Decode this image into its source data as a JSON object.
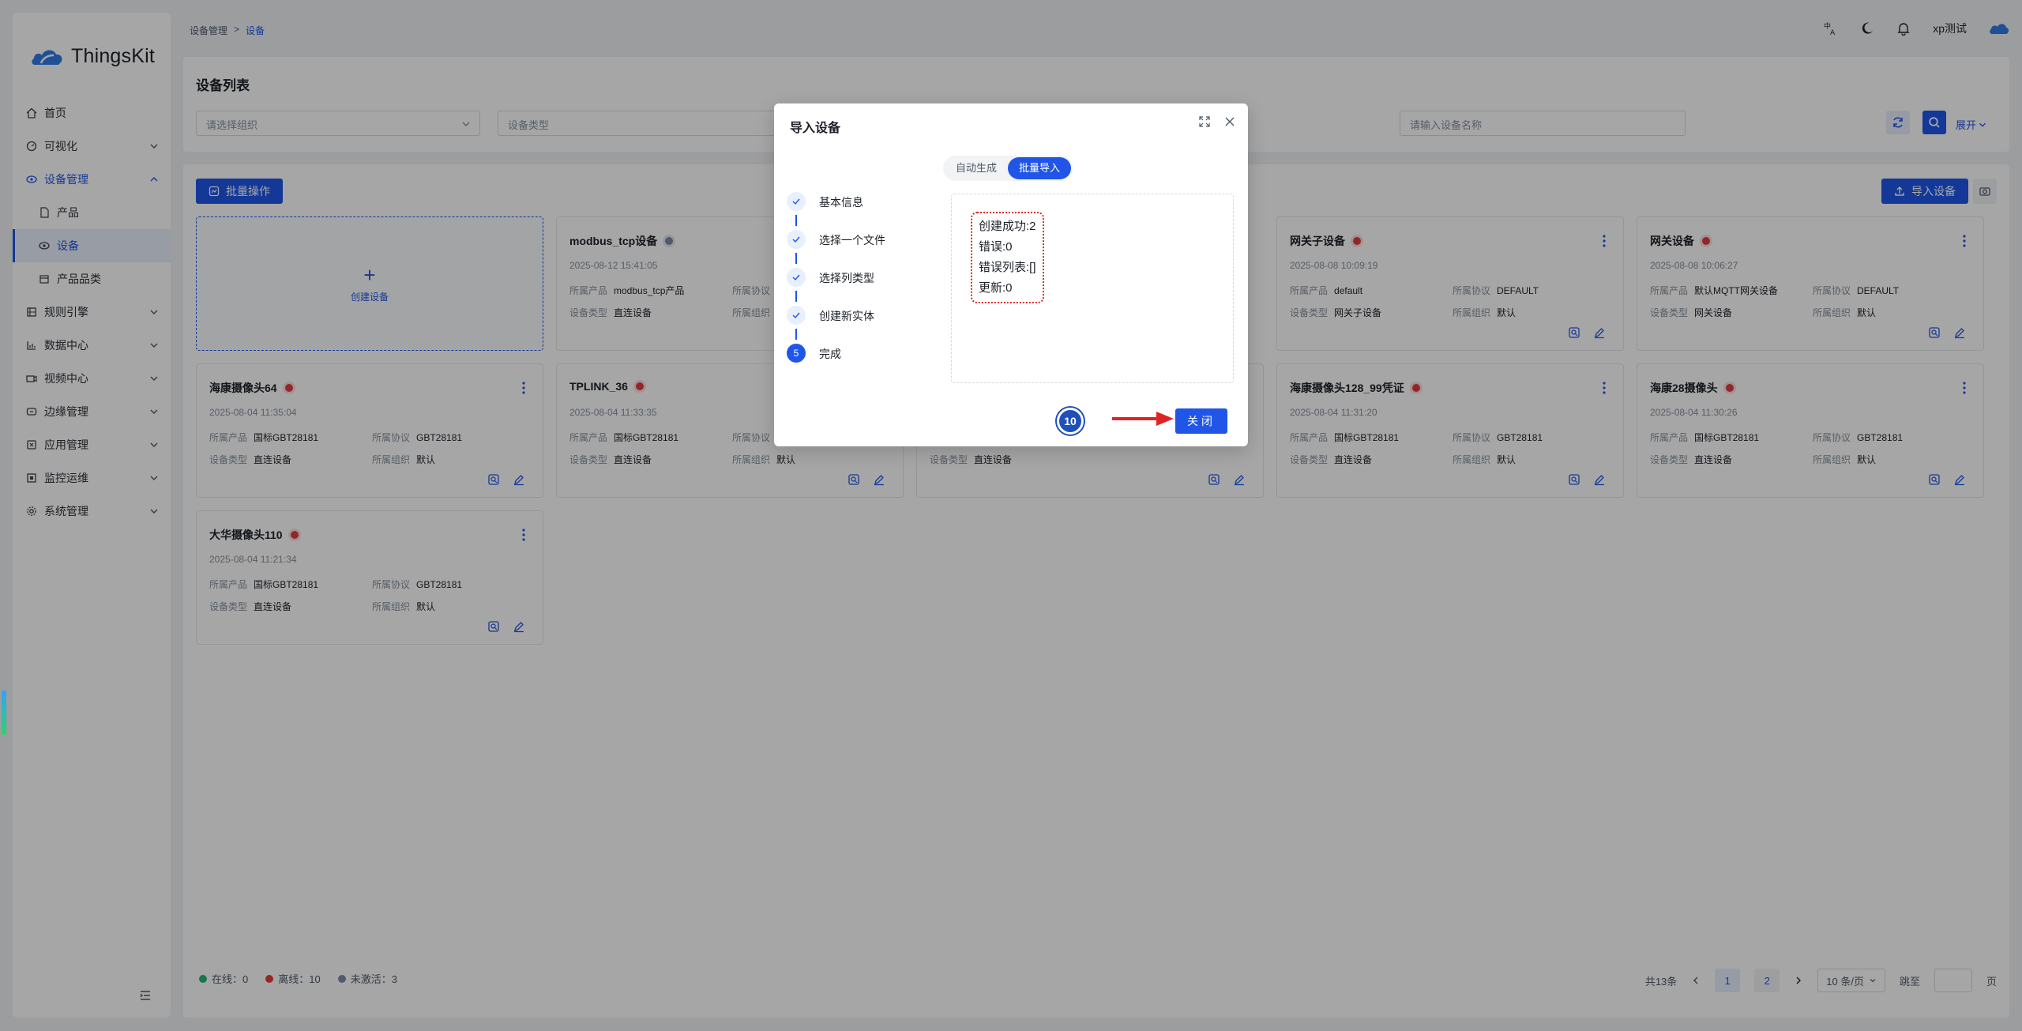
{
  "app": {
    "brand": "ThingsKit"
  },
  "breadcrumb": {
    "parent": "设备管理",
    "sep": ">",
    "current": "设备"
  },
  "topbar": {
    "user": "xp测试",
    "icons": [
      "translate-icon",
      "moon-icon",
      "bell-icon",
      "cloud-icon"
    ]
  },
  "sidebar": {
    "items": [
      {
        "label": "首页",
        "icon": "home-icon"
      },
      {
        "label": "可视化",
        "icon": "dashboard-icon"
      },
      {
        "label": "设备管理",
        "icon": "device-mgmt-icon"
      },
      {
        "label": "产品",
        "icon": "file-icon"
      },
      {
        "label": "设备",
        "icon": "eye-icon"
      },
      {
        "label": "产品品类",
        "icon": "box-icon"
      },
      {
        "label": "规则引擎",
        "icon": "rule-icon"
      },
      {
        "label": "数据中心",
        "icon": "chart-icon"
      },
      {
        "label": "视频中心",
        "icon": "video-icon"
      },
      {
        "label": "边缘管理",
        "icon": "edge-icon"
      },
      {
        "label": "应用管理",
        "icon": "app-icon"
      },
      {
        "label": "监控运维",
        "icon": "monitor-icon"
      },
      {
        "label": "系统管理",
        "icon": "settings-icon"
      }
    ]
  },
  "search": {
    "title": "设备列表",
    "org_placeholder": "请选择组织",
    "type_placeholder": "设备类型",
    "name_placeholder": "请输入设备名称",
    "expand": "展开"
  },
  "toolbar": {
    "batch": "批量操作",
    "import": "导入设备"
  },
  "create_card": {
    "plus": "+",
    "label": "创建设备"
  },
  "field_labels": {
    "product": "所属产品",
    "protocol": "所属协议",
    "type": "设备类型",
    "org": "所属组织"
  },
  "devices": [
    {
      "name": "modbus_tcp设备",
      "status": "inactive",
      "time": "2025-08-12 15:41:05",
      "product": "modbus_tcp产品",
      "protocol": "",
      "type": "直连设备",
      "org": ""
    },
    {
      "name": "网关子设备",
      "status": "offline",
      "time": "2025-08-08 10:09:19",
      "product": "default",
      "protocol": "DEFAULT",
      "type": "网关子设备",
      "org": "默认"
    },
    {
      "name": "网关设备",
      "status": "offline",
      "time": "2025-08-08 10:06:27",
      "product": "默认MQTT网关设备",
      "protocol": "DEFAULT",
      "type": "网关设备",
      "org": "默认"
    },
    {
      "name": "海康摄像头64",
      "status": "offline",
      "time": "2025-08-04 11:35:04",
      "product": "国标GBT28181",
      "protocol": "GBT28181",
      "type": "直连设备",
      "org": "默认"
    },
    {
      "name": "TPLINK_36",
      "status": "offline",
      "time": "2025-08-04 11:33:35",
      "product": "国标GBT28181",
      "protocol": "",
      "type": "直连设备",
      "org": "默认"
    },
    {
      "name": "",
      "status": "",
      "time": "",
      "product": "",
      "protocol": "",
      "type": "直连设备",
      "org": ""
    },
    {
      "name": "海康摄像头128_99凭证",
      "status": "offline",
      "time": "2025-08-04 11:31:20",
      "product": "国标GBT28181",
      "protocol": "GBT28181",
      "type": "直连设备",
      "org": "默认"
    },
    {
      "name": "海康28摄像头",
      "status": "offline",
      "time": "2025-08-04 11:30:26",
      "product": "国标GBT28181",
      "protocol": "GBT28181",
      "type": "直连设备",
      "org": "默认"
    },
    {
      "name": "大华摄像头110",
      "status": "offline",
      "time": "2025-08-04 11:21:34",
      "product": "国标GBT28181",
      "protocol": "GBT28181",
      "type": "直连设备",
      "org": "默认"
    }
  ],
  "legend": {
    "online": "在线：0",
    "offline": "离线：10",
    "inactive": "未激活：3",
    "colors": {
      "online": "#22b573",
      "offline": "#e23c3c",
      "inactive": "#7c8aa6"
    }
  },
  "pagination": {
    "total": "共13条",
    "pages": [
      "1",
      "2"
    ],
    "size": "10 条/页",
    "jump": "跳至",
    "unit": "页"
  },
  "modal": {
    "title": "导入设备",
    "tabs": [
      "自动生成",
      "批量导入"
    ],
    "active_tab": "批量导入",
    "steps": [
      "基本信息",
      "选择一个文件",
      "选择列类型",
      "创建新实体",
      "完成"
    ],
    "current_step_number": "5",
    "result": [
      "创建成功:2",
      "错误:0",
      "错误列表:[]",
      "更新:0"
    ],
    "annotation_number": "10",
    "close": "关闭"
  },
  "colors": {
    "accent": "#2056e8",
    "annotation_red": "#e02424"
  }
}
